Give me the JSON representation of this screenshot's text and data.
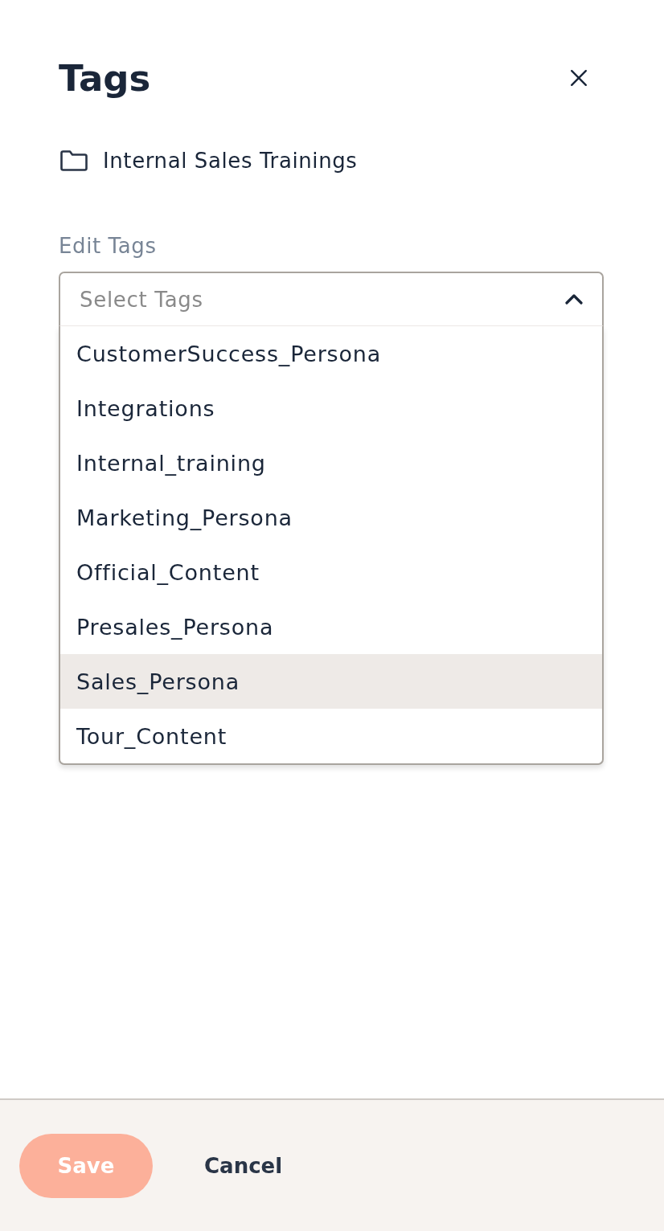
{
  "panel": {
    "title": "Tags",
    "folder": "Internal Sales Trainings"
  },
  "field": {
    "label": "Edit Tags",
    "placeholder": "Select Tags",
    "expanded": true
  },
  "options": [
    {
      "label": "CustomerSuccess_Persona",
      "selected": false
    },
    {
      "label": "Integrations",
      "selected": false
    },
    {
      "label": "Internal_training",
      "selected": false
    },
    {
      "label": "Marketing_Persona",
      "selected": false
    },
    {
      "label": "Official_Content",
      "selected": false
    },
    {
      "label": "Presales_Persona",
      "selected": false
    },
    {
      "label": "Sales_Persona",
      "selected": true
    },
    {
      "label": "Tour_Content",
      "selected": false
    }
  ],
  "footer": {
    "buttons": [
      {
        "label": "Save",
        "kind": "primary",
        "disabled": true
      },
      {
        "label": "Cancel",
        "kind": "text",
        "disabled": false
      }
    ]
  }
}
